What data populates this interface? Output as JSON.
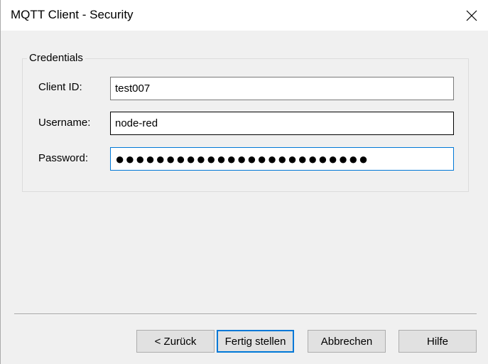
{
  "window": {
    "title": "MQTT Client - Security",
    "close_icon": "close-icon"
  },
  "credentials": {
    "group_label": "Credentials",
    "client_id": {
      "label": "Client ID:",
      "value": "test007"
    },
    "username": {
      "label": "Username:",
      "value": "node-red"
    },
    "password": {
      "label": "Password:",
      "value": "●●●●●●●●●●●●●●●●●●●●●●●●●"
    }
  },
  "buttons": {
    "back": "< Zurück",
    "finish": "Fertig stellen",
    "cancel": "Abbrechen",
    "help": "Hilfe"
  },
  "colors": {
    "focus_accent": "#0078d7",
    "dialog_background": "#f0f0f0"
  }
}
